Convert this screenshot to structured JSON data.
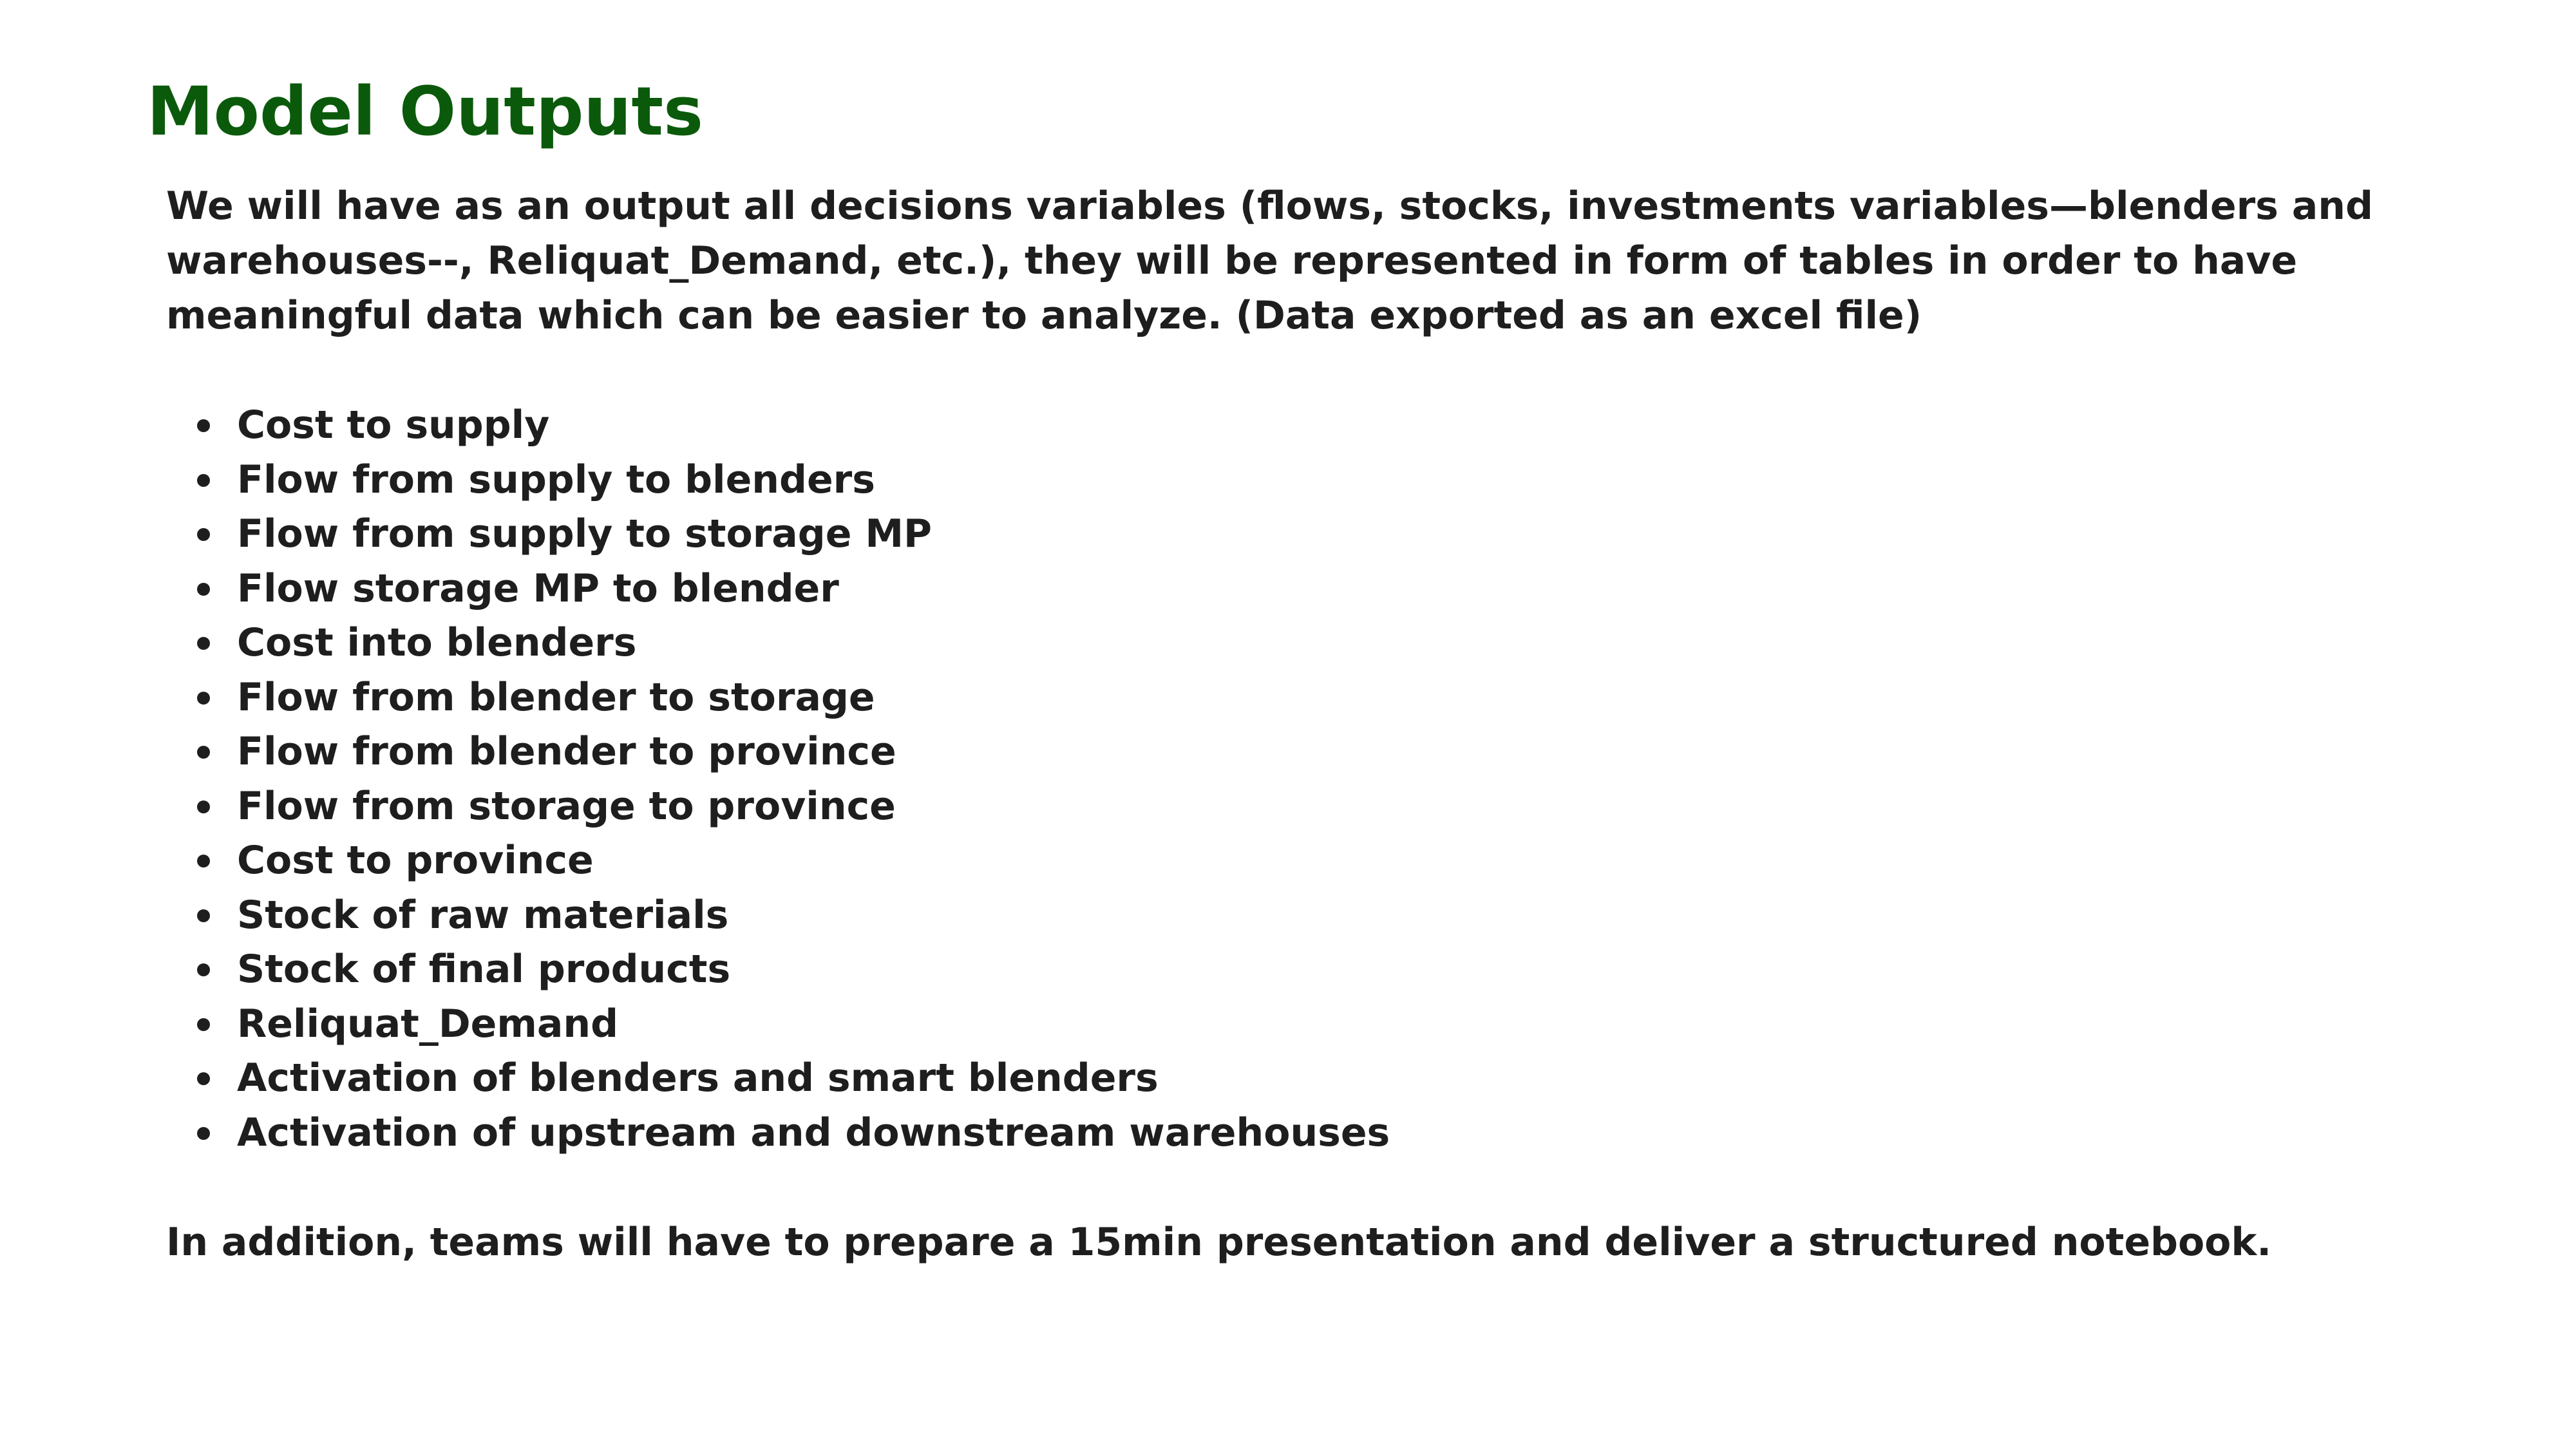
{
  "slide": {
    "title": "Model Outputs",
    "intro": "We will have as an output all decisions variables (flows, stocks, investments variables—blenders and warehouses--, Reliquat_Demand, etc.), they will be represented in form of tables in order to have meaningful data which can be easier to analyze. (Data exported as an excel file)",
    "bullets": [
      "Cost to supply",
      "Flow from supply to blenders",
      "Flow from supply to storage MP",
      "Flow storage MP to blender",
      "Cost into blenders",
      "Flow from blender to storage",
      "Flow from blender to province",
      "Flow from storage to province",
      "Cost to province",
      "Stock of raw materials",
      "Stock of final products",
      "Reliquat_Demand",
      "Activation of blenders and smart blenders",
      "Activation of upstream and downstream warehouses"
    ],
    "closing": "In addition, teams will have to prepare a 15min presentation and deliver a structured notebook."
  },
  "colors": {
    "title": "#0b5a0b",
    "body_text": "#1e1e1e",
    "background": "#ffffff"
  }
}
